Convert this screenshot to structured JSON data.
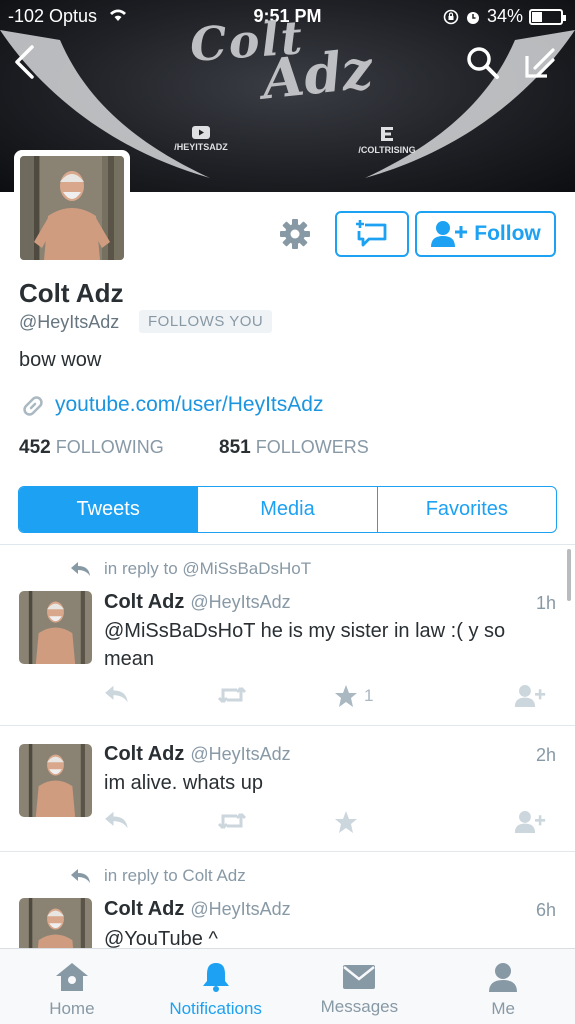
{
  "status_bar": {
    "carrier": "-102 Optus",
    "time": "9:51 PM",
    "battery": "34%",
    "battery_level": 0.34
  },
  "banner": {
    "logo_line1": "Colt",
    "logo_line2": "Adz",
    "social_youtube": "/HEYITSADZ",
    "social_coltrising": "/COLTRISING"
  },
  "profile": {
    "name": "Colt Adz",
    "handle": "@HeyItsAdz",
    "follows_you": "FOLLOWS YOU",
    "bio": "bow wow",
    "link": "youtube.com/user/HeyItsAdz",
    "following_count": "452",
    "following_label": "FOLLOWING",
    "followers_count": "851",
    "followers_label": "FOLLOWERS",
    "follow_label": "Follow"
  },
  "tabs": [
    "Tweets",
    "Media",
    "Favorites"
  ],
  "tweets": [
    {
      "reply_to": "in reply to @MiSsBaDsHoT",
      "name": "Colt Adz",
      "handle": "@HeyItsAdz",
      "time": "1h",
      "text": "@MiSsBaDsHoT he is my sister in law :( y so mean",
      "favorites": "1"
    },
    {
      "name": "Colt Adz",
      "handle": "@HeyItsAdz",
      "time": "2h",
      "text": "im alive. whats up"
    },
    {
      "reply_to": "in reply to Colt Adz",
      "name": "Colt Adz",
      "handle": "@HeyItsAdz",
      "time": "6h",
      "text": "@YouTube ^"
    }
  ],
  "tabbar": [
    "Home",
    "Notifications",
    "Messages",
    "Me"
  ],
  "colors": {
    "accent": "#1da1f2",
    "text": "#292f33",
    "muted": "#8899a6"
  }
}
